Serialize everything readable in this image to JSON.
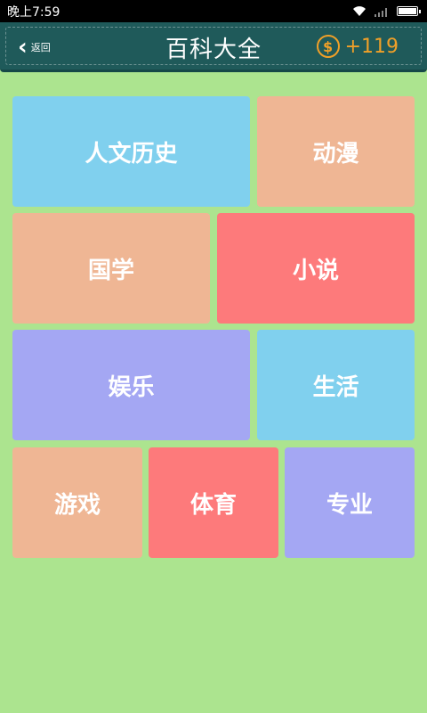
{
  "status_bar": {
    "time": "晚上7:59"
  },
  "header": {
    "back_label": "返回",
    "title": "百科大全",
    "coin_symbol": "$",
    "coin_count": "+119"
  },
  "colors": {
    "background": "#ace48f",
    "header": "#1f5a5a",
    "coin": "#f0a028",
    "blue": "#80d0ee",
    "peach": "#efb694",
    "red": "#fd7a7b",
    "purple": "#a4a7f3"
  },
  "categories": [
    {
      "label": "人文历史",
      "color": "#80d0ee"
    },
    {
      "label": "动漫",
      "color": "#efb694"
    },
    {
      "label": "国学",
      "color": "#efb694"
    },
    {
      "label": "小说",
      "color": "#fd7a7b"
    },
    {
      "label": "娱乐",
      "color": "#a4a7f3"
    },
    {
      "label": "生活",
      "color": "#80d0ee"
    },
    {
      "label": "游戏",
      "color": "#efb694"
    },
    {
      "label": "体育",
      "color": "#fd7a7b"
    },
    {
      "label": "专业",
      "color": "#a4a7f3"
    }
  ]
}
